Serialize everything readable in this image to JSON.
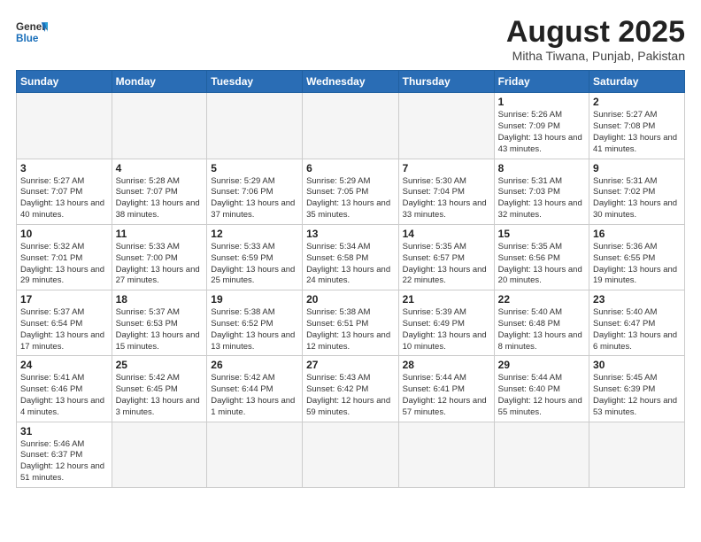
{
  "header": {
    "logo_general": "General",
    "logo_blue": "Blue",
    "month_title": "August 2025",
    "location": "Mitha Tiwana, Punjab, Pakistan"
  },
  "weekdays": [
    "Sunday",
    "Monday",
    "Tuesday",
    "Wednesday",
    "Thursday",
    "Friday",
    "Saturday"
  ],
  "weeks": [
    [
      {
        "day": "",
        "info": ""
      },
      {
        "day": "",
        "info": ""
      },
      {
        "day": "",
        "info": ""
      },
      {
        "day": "",
        "info": ""
      },
      {
        "day": "",
        "info": ""
      },
      {
        "day": "1",
        "info": "Sunrise: 5:26 AM\nSunset: 7:09 PM\nDaylight: 13 hours and 43 minutes."
      },
      {
        "day": "2",
        "info": "Sunrise: 5:27 AM\nSunset: 7:08 PM\nDaylight: 13 hours and 41 minutes."
      }
    ],
    [
      {
        "day": "3",
        "info": "Sunrise: 5:27 AM\nSunset: 7:07 PM\nDaylight: 13 hours and 40 minutes."
      },
      {
        "day": "4",
        "info": "Sunrise: 5:28 AM\nSunset: 7:07 PM\nDaylight: 13 hours and 38 minutes."
      },
      {
        "day": "5",
        "info": "Sunrise: 5:29 AM\nSunset: 7:06 PM\nDaylight: 13 hours and 37 minutes."
      },
      {
        "day": "6",
        "info": "Sunrise: 5:29 AM\nSunset: 7:05 PM\nDaylight: 13 hours and 35 minutes."
      },
      {
        "day": "7",
        "info": "Sunrise: 5:30 AM\nSunset: 7:04 PM\nDaylight: 13 hours and 33 minutes."
      },
      {
        "day": "8",
        "info": "Sunrise: 5:31 AM\nSunset: 7:03 PM\nDaylight: 13 hours and 32 minutes."
      },
      {
        "day": "9",
        "info": "Sunrise: 5:31 AM\nSunset: 7:02 PM\nDaylight: 13 hours and 30 minutes."
      }
    ],
    [
      {
        "day": "10",
        "info": "Sunrise: 5:32 AM\nSunset: 7:01 PM\nDaylight: 13 hours and 29 minutes."
      },
      {
        "day": "11",
        "info": "Sunrise: 5:33 AM\nSunset: 7:00 PM\nDaylight: 13 hours and 27 minutes."
      },
      {
        "day": "12",
        "info": "Sunrise: 5:33 AM\nSunset: 6:59 PM\nDaylight: 13 hours and 25 minutes."
      },
      {
        "day": "13",
        "info": "Sunrise: 5:34 AM\nSunset: 6:58 PM\nDaylight: 13 hours and 24 minutes."
      },
      {
        "day": "14",
        "info": "Sunrise: 5:35 AM\nSunset: 6:57 PM\nDaylight: 13 hours and 22 minutes."
      },
      {
        "day": "15",
        "info": "Sunrise: 5:35 AM\nSunset: 6:56 PM\nDaylight: 13 hours and 20 minutes."
      },
      {
        "day": "16",
        "info": "Sunrise: 5:36 AM\nSunset: 6:55 PM\nDaylight: 13 hours and 19 minutes."
      }
    ],
    [
      {
        "day": "17",
        "info": "Sunrise: 5:37 AM\nSunset: 6:54 PM\nDaylight: 13 hours and 17 minutes."
      },
      {
        "day": "18",
        "info": "Sunrise: 5:37 AM\nSunset: 6:53 PM\nDaylight: 13 hours and 15 minutes."
      },
      {
        "day": "19",
        "info": "Sunrise: 5:38 AM\nSunset: 6:52 PM\nDaylight: 13 hours and 13 minutes."
      },
      {
        "day": "20",
        "info": "Sunrise: 5:38 AM\nSunset: 6:51 PM\nDaylight: 13 hours and 12 minutes."
      },
      {
        "day": "21",
        "info": "Sunrise: 5:39 AM\nSunset: 6:49 PM\nDaylight: 13 hours and 10 minutes."
      },
      {
        "day": "22",
        "info": "Sunrise: 5:40 AM\nSunset: 6:48 PM\nDaylight: 13 hours and 8 minutes."
      },
      {
        "day": "23",
        "info": "Sunrise: 5:40 AM\nSunset: 6:47 PM\nDaylight: 13 hours and 6 minutes."
      }
    ],
    [
      {
        "day": "24",
        "info": "Sunrise: 5:41 AM\nSunset: 6:46 PM\nDaylight: 13 hours and 4 minutes."
      },
      {
        "day": "25",
        "info": "Sunrise: 5:42 AM\nSunset: 6:45 PM\nDaylight: 13 hours and 3 minutes."
      },
      {
        "day": "26",
        "info": "Sunrise: 5:42 AM\nSunset: 6:44 PM\nDaylight: 13 hours and 1 minute."
      },
      {
        "day": "27",
        "info": "Sunrise: 5:43 AM\nSunset: 6:42 PM\nDaylight: 12 hours and 59 minutes."
      },
      {
        "day": "28",
        "info": "Sunrise: 5:44 AM\nSunset: 6:41 PM\nDaylight: 12 hours and 57 minutes."
      },
      {
        "day": "29",
        "info": "Sunrise: 5:44 AM\nSunset: 6:40 PM\nDaylight: 12 hours and 55 minutes."
      },
      {
        "day": "30",
        "info": "Sunrise: 5:45 AM\nSunset: 6:39 PM\nDaylight: 12 hours and 53 minutes."
      }
    ],
    [
      {
        "day": "31",
        "info": "Sunrise: 5:46 AM\nSunset: 6:37 PM\nDaylight: 12 hours and 51 minutes."
      },
      {
        "day": "",
        "info": ""
      },
      {
        "day": "",
        "info": ""
      },
      {
        "day": "",
        "info": ""
      },
      {
        "day": "",
        "info": ""
      },
      {
        "day": "",
        "info": ""
      },
      {
        "day": "",
        "info": ""
      }
    ]
  ]
}
